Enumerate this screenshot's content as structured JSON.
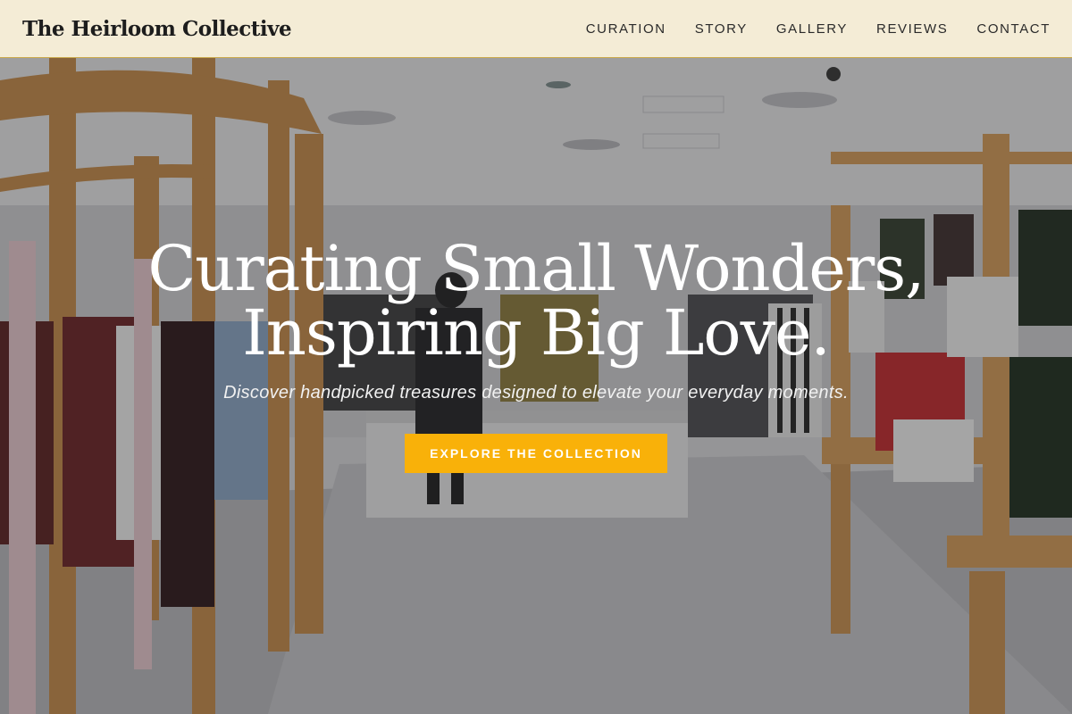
{
  "header": {
    "brand": "The Heirloom Collective",
    "nav": [
      {
        "label": "CURATION"
      },
      {
        "label": "STORY"
      },
      {
        "label": "GALLERY"
      },
      {
        "label": "REVIEWS"
      },
      {
        "label": "CONTACT"
      }
    ]
  },
  "hero": {
    "title_line1": "Curating Small Wonders,",
    "title_line2": "Inspiring Big Love.",
    "subtitle": "Discover handpicked treasures designed to elevate your everyday moments.",
    "cta_label": "EXPLORE THE COLLECTION"
  },
  "colors": {
    "header_bg": "#f4ecd6",
    "header_border": "#c9a84a",
    "cta_bg": "#f9b109",
    "text_light": "#ffffff"
  }
}
